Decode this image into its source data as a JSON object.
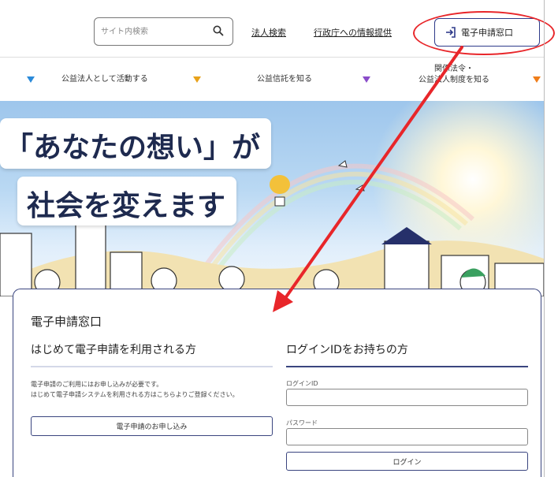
{
  "header": {
    "search": {
      "placeholder": "サイト内検索",
      "value": ""
    },
    "links": [
      {
        "label": "法人検索"
      },
      {
        "label": "行政庁への情報提供"
      }
    ],
    "apply_button": {
      "label": "電子申請窓口",
      "icon": "login-arrow-icon"
    }
  },
  "category_nav": {
    "items": [
      {
        "label": "公益法人として活動する",
        "marker_color": "#2b8ad9"
      },
      {
        "label": "公益信託を知る",
        "marker_color": "#e8a21a"
      },
      {
        "label_line1": "関係法令・",
        "label_line2": "公益法人制度を知る",
        "marker_color": "#8a4cc9"
      },
      {
        "marker_color": "#ef7d1a"
      }
    ],
    "first_marker_color": "#2b8ad9"
  },
  "hero": {
    "line1": "「あなたの想い」が",
    "line2": "社会を変えます"
  },
  "panel": {
    "title": "電子申請窓口",
    "first_time": {
      "heading": "はじめて電子申請を利用される方",
      "note_line1": "電子申請のご利用にはお申し込みが必要です。",
      "note_line2": "はじめて電子申請システムを利用される方はこちらよりご登録ください。",
      "signup_button": "電子申請のお申し込み"
    },
    "login": {
      "heading": "ログインIDをお持ちの方",
      "id_label": "ログインID",
      "id_value": "",
      "password_label": "パスワード",
      "password_value": "",
      "login_button": "ログイン"
    }
  },
  "annotation": {
    "color": "#e8262a"
  }
}
